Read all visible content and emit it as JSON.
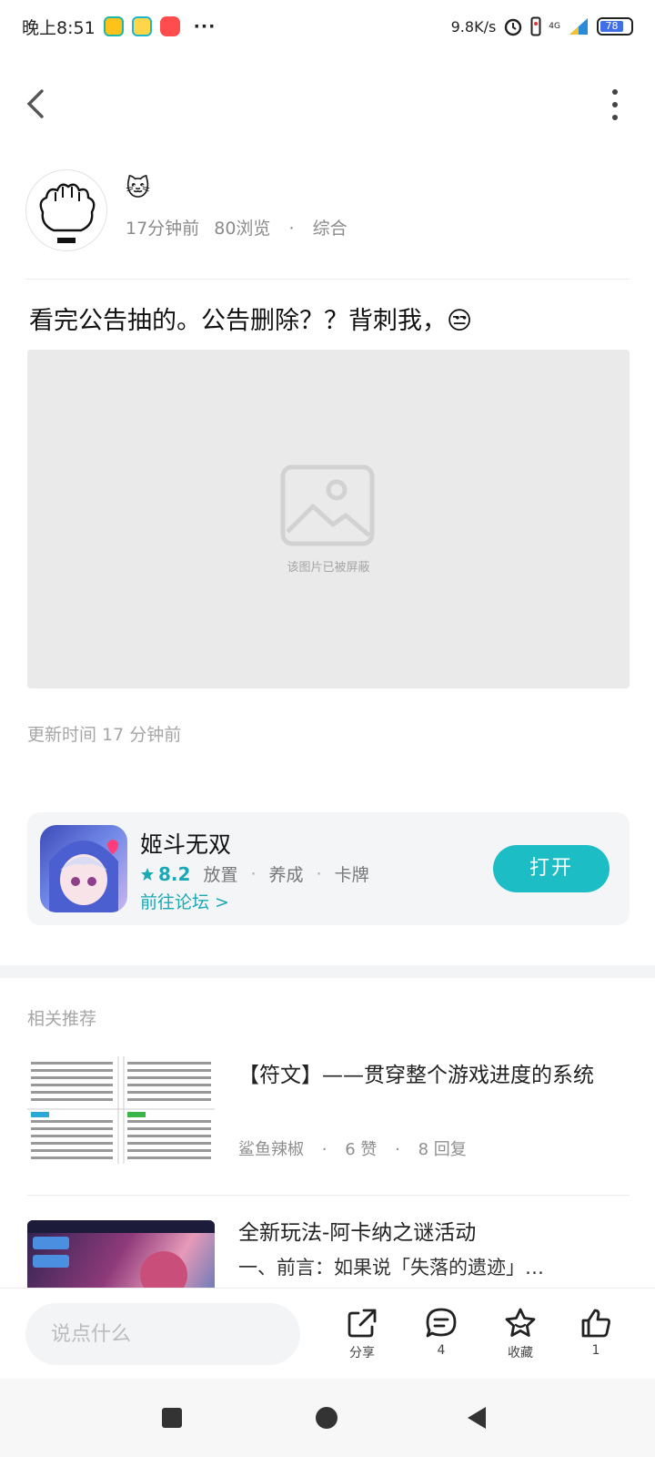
{
  "status_bar": {
    "time": "晚上8:51",
    "more": "···",
    "net_speed": "9.8K/s",
    "signal": "4G",
    "battery": "78"
  },
  "author": {
    "name_emoji": "🐱",
    "time_ago": "17分钟前",
    "views": "80浏览",
    "separator": "·",
    "category": "综合"
  },
  "post": {
    "title": "看完公告抽的。公告删除？？背刺我，😒",
    "blocked_text": "该图片已被屏蔽",
    "update_time": "更新时间 17 分钟前"
  },
  "game_card": {
    "name": "姬斗无双",
    "rating": "8.2",
    "tags": [
      "放置",
      "养成",
      "卡牌"
    ],
    "separator": "·",
    "forum_link": "前往论坛 >",
    "open_button": "打开"
  },
  "related": {
    "title": "相关推荐",
    "items": [
      {
        "title": "【符文】——贯穿整个游戏进度的系统",
        "author": "鲨鱼辣椒",
        "likes": "6 赞",
        "replies": "8 回复"
      },
      {
        "title": "全新玩法-阿卡纳之谜活动",
        "excerpt": "一、前言：如果说「失落的遗迹」…"
      }
    ]
  },
  "bottom_bar": {
    "input_placeholder": "说点什么",
    "share_label": "分享",
    "comment_count": "4",
    "favorite_label": "收藏",
    "like_count": "1"
  }
}
